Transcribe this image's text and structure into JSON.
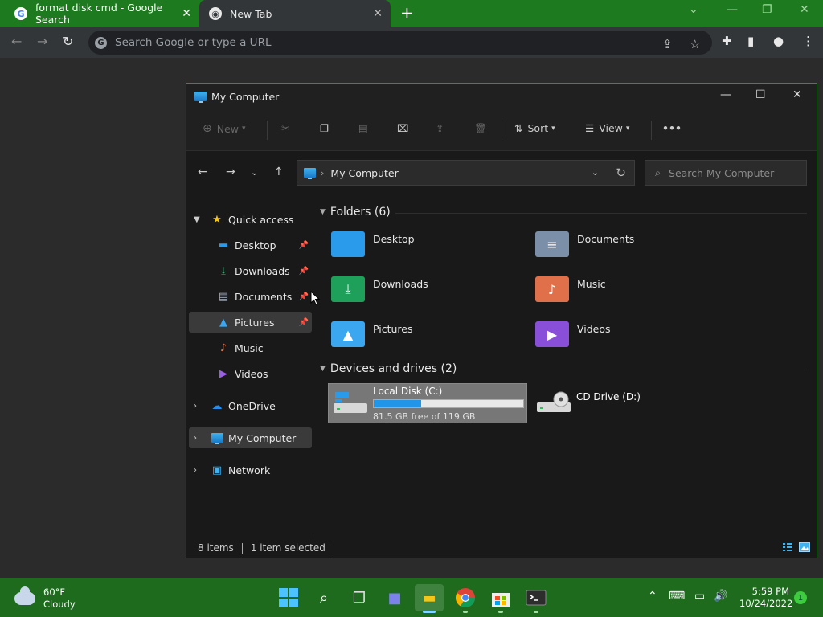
{
  "browser": {
    "tabs": [
      {
        "title": "format disk cmd - Google Search",
        "active": false
      },
      {
        "title": "New Tab",
        "active": true
      }
    ],
    "omnibox_placeholder": "Search Google or type a URL"
  },
  "explorer": {
    "title": "My Computer",
    "commands": {
      "new": "New",
      "sort": "Sort",
      "view": "View"
    },
    "address": "My Computer",
    "search_placeholder": "Search My Computer",
    "nav": {
      "quick_access": "Quick access",
      "quick_items": [
        {
          "label": "Desktop",
          "pinned": true
        },
        {
          "label": "Downloads",
          "pinned": true
        },
        {
          "label": "Documents",
          "pinned": true
        },
        {
          "label": "Pictures",
          "pinned": true
        },
        {
          "label": "Music",
          "pinned": false
        },
        {
          "label": "Videos",
          "pinned": false
        }
      ],
      "onedrive": "OneDrive",
      "my_computer": "My Computer",
      "network": "Network"
    },
    "folders_header": "Folders (6)",
    "folders": [
      {
        "label": "Desktop",
        "color": "#2a9bea"
      },
      {
        "label": "Documents",
        "color": "#7b8fa8"
      },
      {
        "label": "Downloads",
        "color": "#1fa05a"
      },
      {
        "label": "Music",
        "color": "#e0704a"
      },
      {
        "label": "Pictures",
        "color": "#3ba7f0"
      },
      {
        "label": "Videos",
        "color": "#8a4fd8"
      }
    ],
    "drives_header": "Devices and drives (2)",
    "drives": [
      {
        "label": "Local Disk (C:)",
        "free_text": "81.5 GB free of 119 GB",
        "used_fraction": 0.315,
        "selected": true
      },
      {
        "label": "CD Drive (D:)",
        "selected": false
      }
    ],
    "status": {
      "items": "8 items",
      "selected": "1 item selected"
    }
  },
  "taskbar": {
    "weather_temp": "60°F",
    "weather_desc": "Cloudy",
    "time": "5:59 PM",
    "date": "10/24/2022",
    "notification_count": "1"
  }
}
